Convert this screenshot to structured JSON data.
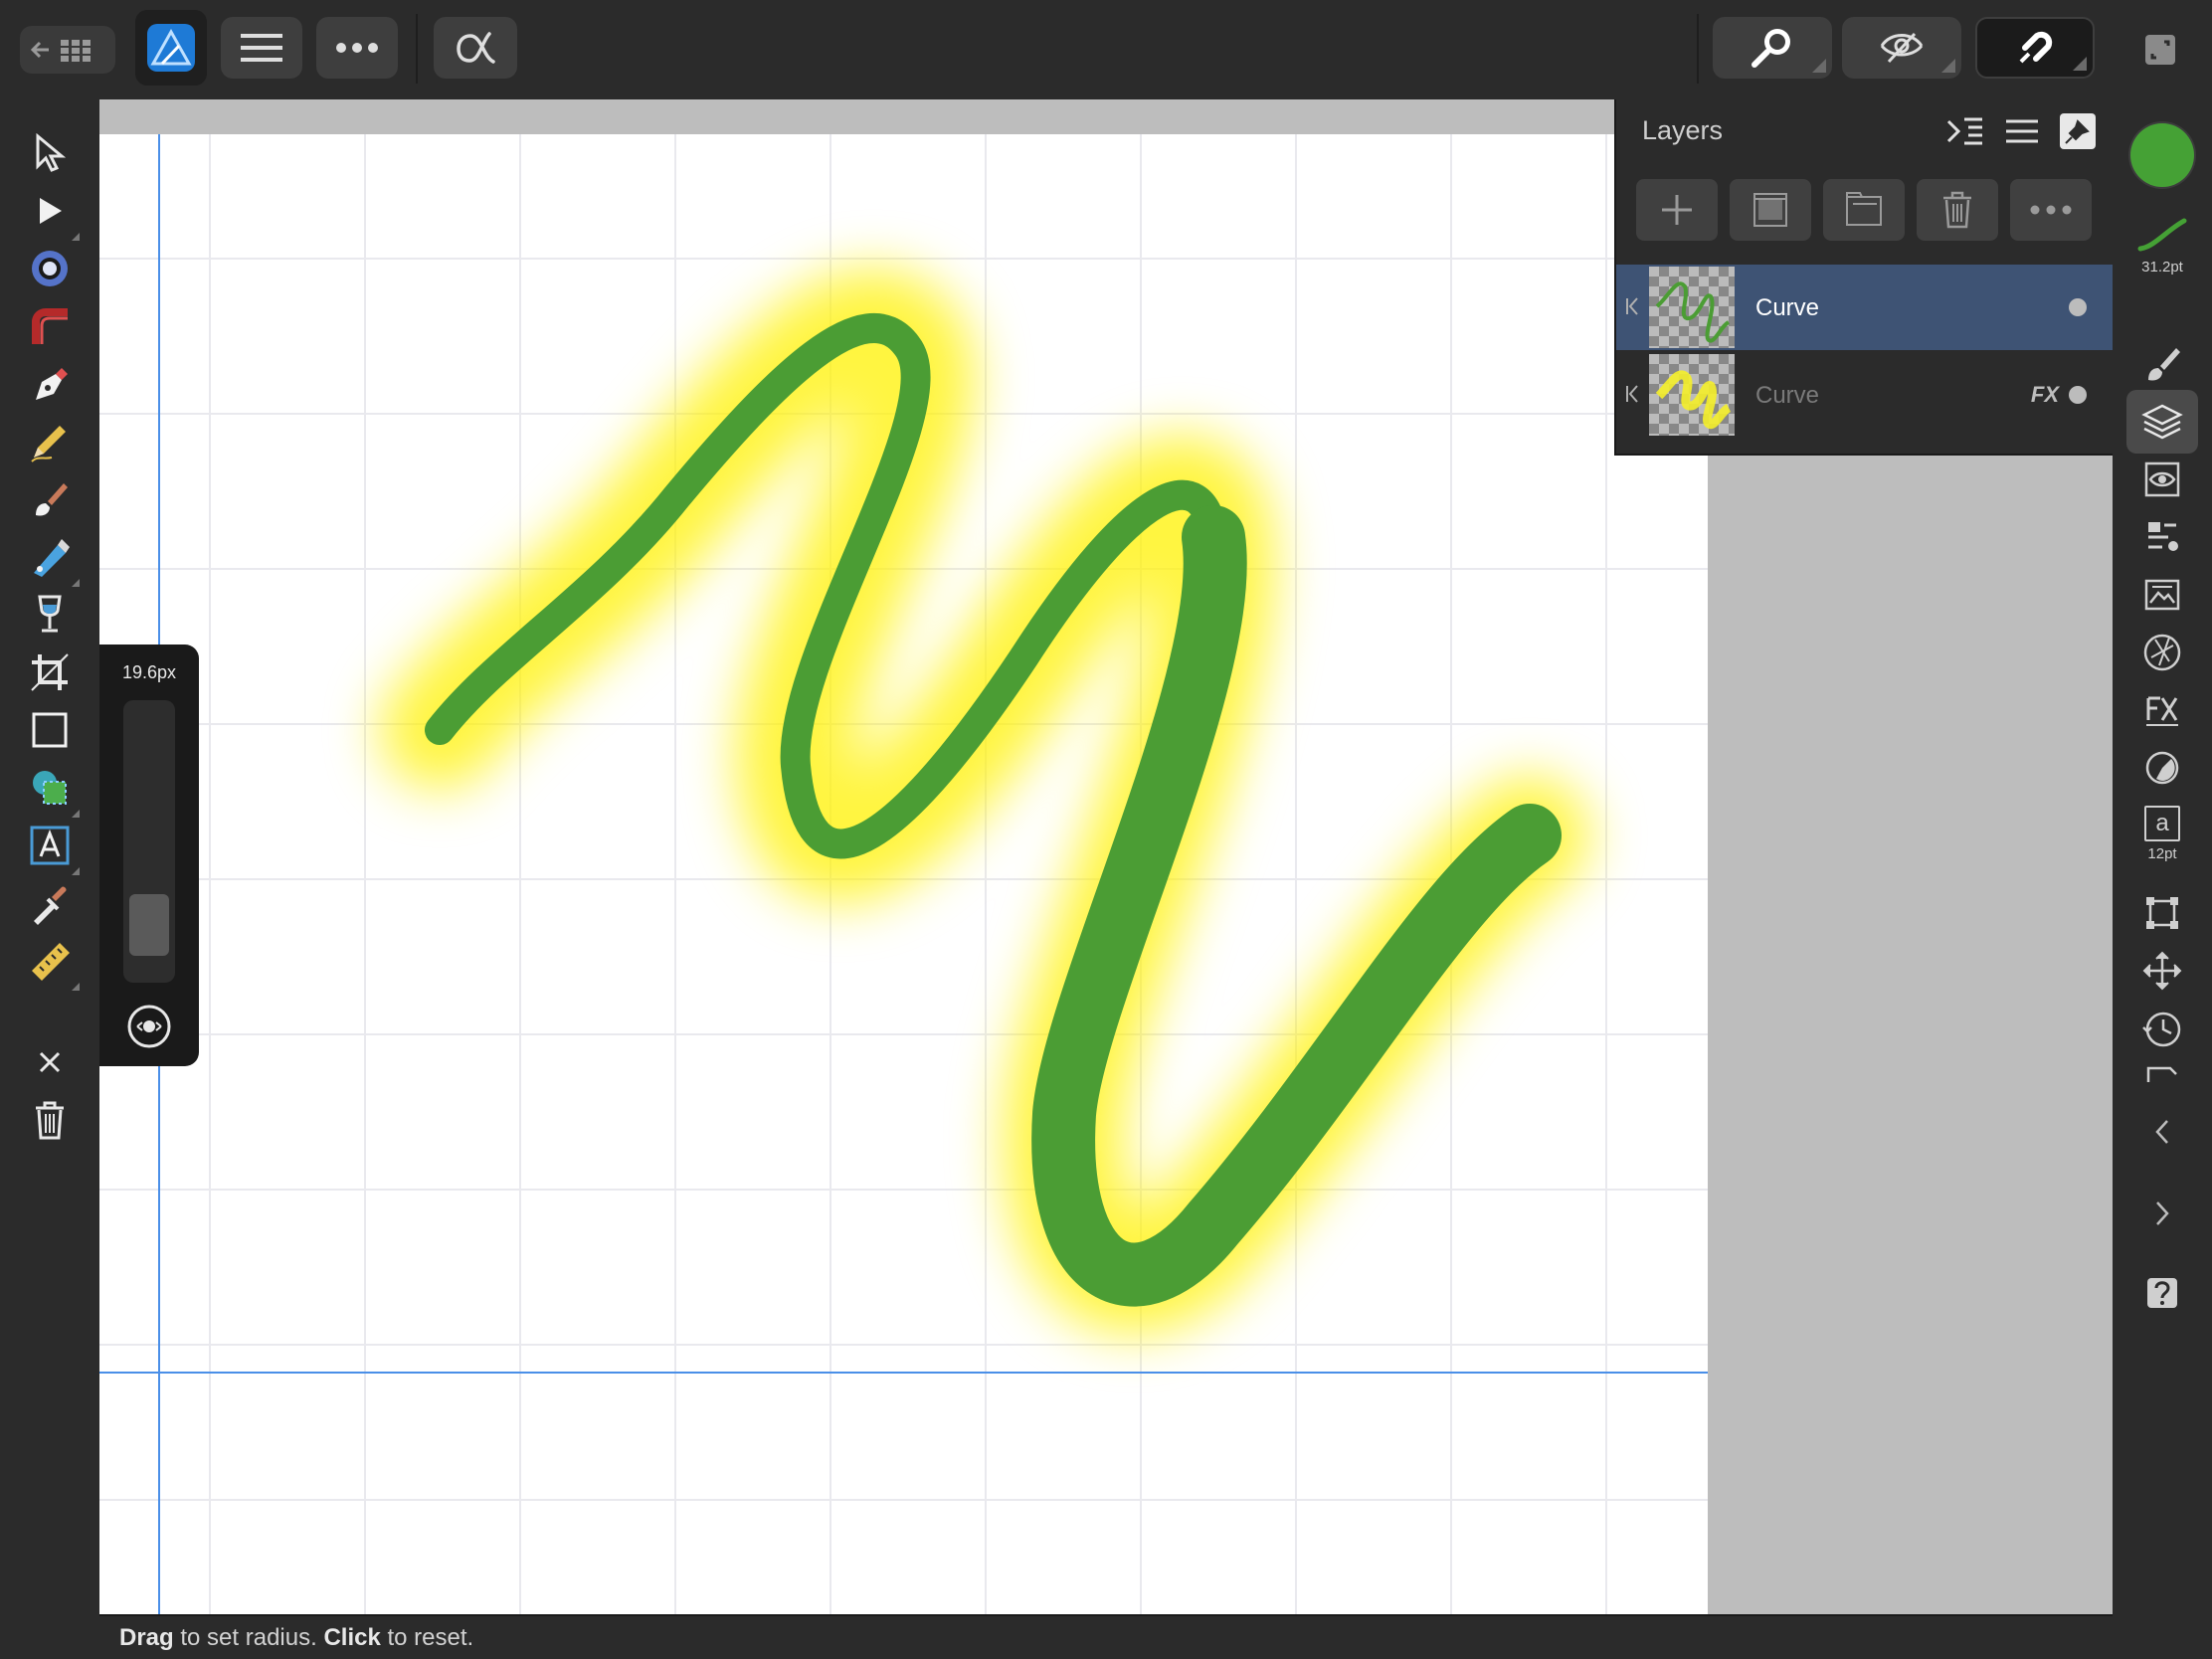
{
  "topbar": {
    "buttons": [
      "back-to-gallery",
      "app-persona",
      "document-menu",
      "more",
      "assistant"
    ],
    "right_buttons": [
      "zoom",
      "view-mode",
      "snapping"
    ]
  },
  "left_tools": [
    "move",
    "node",
    "flood-fill",
    "fill",
    "pen",
    "pencil",
    "paint-brush",
    "vector-brush",
    "pixel",
    "crop",
    "rectangle",
    "shape",
    "text",
    "color-picker",
    "ruler",
    "close",
    "delete"
  ],
  "radius_panel": {
    "value": "19.6px",
    "level": 0.1
  },
  "layers": {
    "title": "Layers",
    "rows": [
      {
        "name": "Curve",
        "selected": true,
        "fx": ""
      },
      {
        "name": "Curve",
        "selected": false,
        "fx": "FX"
      }
    ]
  },
  "right_panel": {
    "stroke_width": "31.2pt",
    "font_size": "12pt",
    "text_glyph": "a",
    "fill_color": "#45a135"
  },
  "status": {
    "drag": "Drag",
    "drag_rest": " to set radius. ",
    "click": "Click",
    "click_rest": " to reset."
  },
  "colors": {
    "stroke": "#4b9d34",
    "glow": "#fff200",
    "guide": "#4a8fe8"
  }
}
